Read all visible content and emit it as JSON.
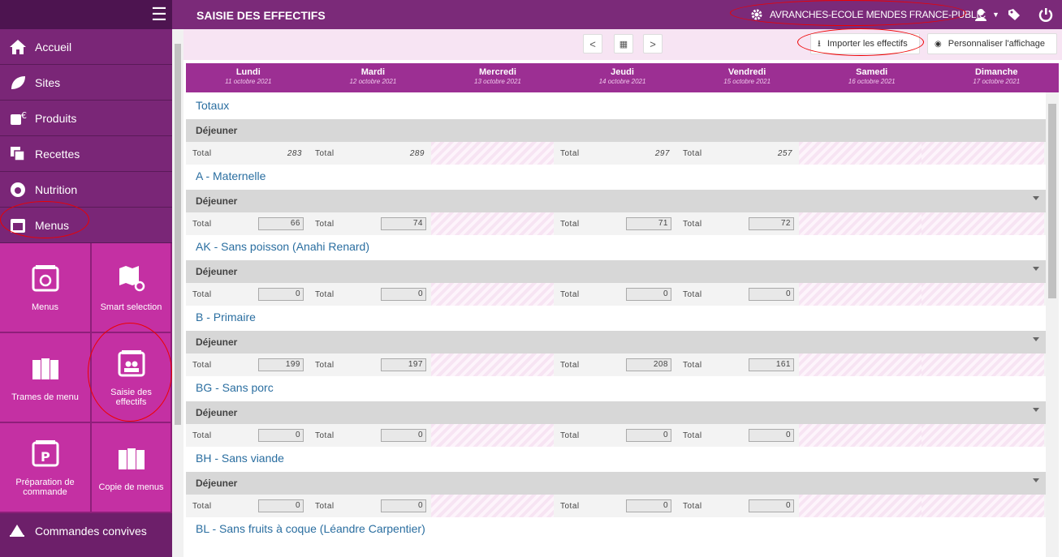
{
  "header": {
    "title": "SAISIE DES EFFECTIFS",
    "site": "AVRANCHES-ECOLE MENDES FRANCE-PUBLIC"
  },
  "sidebar": {
    "items": [
      {
        "label": "Accueil",
        "icon": "home-icon"
      },
      {
        "label": "Sites",
        "icon": "leaf-icon"
      },
      {
        "label": "Produits",
        "icon": "products-icon"
      },
      {
        "label": "Recettes",
        "icon": "recipes-icon"
      },
      {
        "label": "Nutrition",
        "icon": "nutrition-icon"
      },
      {
        "label": "Menus",
        "icon": "calendar-icon"
      }
    ],
    "tiles": [
      {
        "label": "Menus"
      },
      {
        "label": "Smart selection"
      },
      {
        "label": "Trames de menu"
      },
      {
        "label": "Saisie des effectifs"
      },
      {
        "label": "Préparation de commande"
      },
      {
        "label": "Copie de menus"
      }
    ],
    "bottom": "Commandes convives"
  },
  "toolbar": {
    "import_label": "Importer les effectifs",
    "custom_label": "Personnaliser l'affichage"
  },
  "days": [
    {
      "name": "Lundi",
      "date": "11 octobre 2021"
    },
    {
      "name": "Mardi",
      "date": "12 octobre 2021"
    },
    {
      "name": "Mercredi",
      "date": "13 octobre 2021"
    },
    {
      "name": "Jeudi",
      "date": "14 octobre 2021"
    },
    {
      "name": "Vendredi",
      "date": "15 octobre 2021"
    },
    {
      "name": "Samedi",
      "date": "16 octobre 2021"
    },
    {
      "name": "Dimanche",
      "date": "17 octobre 2021"
    }
  ],
  "total_label": "Total",
  "meal_label": "Déjeuner",
  "sections": [
    {
      "title": "Totaux",
      "totals": true,
      "values": [
        "283",
        "289",
        null,
        "297",
        "257",
        null,
        null
      ]
    },
    {
      "title": "A - Maternelle",
      "values": [
        "66",
        "74",
        null,
        "71",
        "72",
        null,
        null
      ]
    },
    {
      "title": "AK - Sans poisson (Anahi Renard)",
      "values": [
        "0",
        "0",
        null,
        "0",
        "0",
        null,
        null
      ]
    },
    {
      "title": "B - Primaire",
      "values": [
        "199",
        "197",
        null,
        "208",
        "161",
        null,
        null
      ]
    },
    {
      "title": "BG - Sans porc",
      "values": [
        "0",
        "0",
        null,
        "0",
        "0",
        null,
        null
      ]
    },
    {
      "title": "BH - Sans viande",
      "values": [
        "0",
        "0",
        null,
        "0",
        "0",
        null,
        null
      ]
    },
    {
      "title": "BL - Sans fruits à coque (Léandre Carpentier)",
      "values": []
    }
  ],
  "colors": {
    "sidebar": "#6d1f6a",
    "tile": "#c430a3",
    "header": "#7b2a79",
    "dayheader": "#9c2f93",
    "link": "#2a6ea0"
  }
}
